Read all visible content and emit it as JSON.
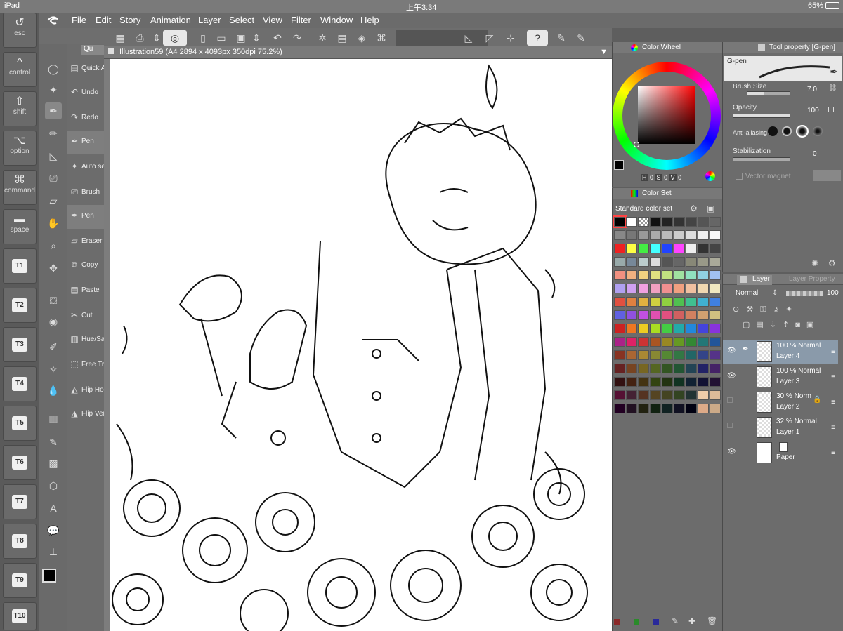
{
  "status": {
    "device": "iPad",
    "time": "上午3:34",
    "battery": "65%"
  },
  "menu": {
    "items": [
      "File",
      "Edit",
      "Story",
      "Animation",
      "Layer",
      "Select",
      "View",
      "Filter",
      "Window",
      "Help"
    ]
  },
  "keys": [
    {
      "label": "esc",
      "glyph": "↺"
    },
    {
      "label": "control",
      "glyph": "^"
    },
    {
      "label": "shift",
      "glyph": "⇧"
    },
    {
      "label": "option",
      "glyph": "⌥"
    },
    {
      "label": "command",
      "glyph": "⌘"
    },
    {
      "label": "space",
      "glyph": "▬"
    },
    {
      "label": "T1"
    },
    {
      "label": "T2"
    },
    {
      "label": "T3"
    },
    {
      "label": "T4"
    },
    {
      "label": "T5"
    },
    {
      "label": "T6"
    },
    {
      "label": "T7"
    },
    {
      "label": "T8"
    },
    {
      "label": "T9"
    },
    {
      "label": "T10"
    }
  ],
  "canvas": {
    "tab_title": "Illustration59 (A4 2894 x 4093px 350dpi 75.2%)"
  },
  "quick_panel": {
    "tab": "Qu",
    "items": [
      {
        "label": "Quick Access",
        "icon": "quick-access-icon"
      },
      {
        "label": "Undo",
        "icon": "undo-icon"
      },
      {
        "label": "Redo",
        "icon": "redo-icon"
      },
      {
        "label": "Pen",
        "icon": "pen-icon"
      },
      {
        "label": "Auto select",
        "icon": "auto-select-icon"
      },
      {
        "label": "Brush",
        "icon": "brush-icon"
      },
      {
        "label": "Pen",
        "icon": "pen-icon"
      },
      {
        "label": "Eraser",
        "icon": "eraser-icon"
      },
      {
        "label": "Copy",
        "icon": "copy-icon"
      },
      {
        "label": "Paste",
        "icon": "paste-icon"
      },
      {
        "label": "Cut",
        "icon": "cut-icon"
      },
      {
        "label": "Hue/Saturation",
        "icon": "hue-saturation-icon"
      },
      {
        "label": "Free Transform",
        "icon": "transform-icon"
      },
      {
        "label": "Flip Horizontal",
        "icon": "flip-horizontal-icon"
      },
      {
        "label": "Flip Vertical",
        "icon": "flip-vertical-icon"
      }
    ]
  },
  "color_wheel": {
    "title": "Color Wheel",
    "h_label": "H",
    "h": "0",
    "s_label": "S",
    "s": "0",
    "v_label": "V",
    "v": "0"
  },
  "color_set": {
    "title": "Color Set",
    "set_name": "Standard color set",
    "colors": [
      [
        "#000000",
        "#ffffff",
        "checker",
        "#111111",
        "#222222",
        "#333333",
        "#444444",
        "#555555",
        "#666666"
      ],
      [
        "#888888",
        "#777777",
        "#999999",
        "#aaaaaa",
        "#bbbbbb",
        "#cccccc",
        "#dddddd",
        "#eeeeee",
        "#f8f8f8"
      ],
      [
        "#ee2222",
        "#ffff44",
        "#44ee44",
        "#44ffff",
        "#2244ff",
        "#ff44ff",
        "#eeeeee",
        "#333333",
        "#444444"
      ],
      [
        "#99aaaa",
        "#778899",
        "#bbcccc",
        "#dddddd",
        "#555555",
        "#666666",
        "#888877",
        "#999988",
        "#aaaa99"
      ],
      [
        "#f09080",
        "#f0b080",
        "#f0d080",
        "#e0e080",
        "#c0e080",
        "#a0e0a0",
        "#90e0c0",
        "#90d0e0",
        "#a0c0f0"
      ],
      [
        "#b0a0f0",
        "#d0a0f0",
        "#f0a0e0",
        "#f0a0c0",
        "#f09090",
        "#f0a080",
        "#f0c0a0",
        "#f0d8b0",
        "#f0e8c0"
      ],
      [
        "#e05040",
        "#e08040",
        "#e0b040",
        "#d0d040",
        "#90d040",
        "#50c050",
        "#40c090",
        "#40b0d0",
        "#4080e0"
      ],
      [
        "#6060e0",
        "#9050e0",
        "#c050e0",
        "#e050b0",
        "#e05080",
        "#d06060",
        "#d08060",
        "#d0a070",
        "#d0c080"
      ],
      [
        "#cc2222",
        "#ee7722",
        "#eecc22",
        "#aadd22",
        "#44cc44",
        "#22aaaa",
        "#2288dd",
        "#4444dd",
        "#8833dd"
      ],
      [
        "#aa2288",
        "#dd2266",
        "#cc3333",
        "#aa5522",
        "#998822",
        "#669922",
        "#338833",
        "#227777",
        "#225599"
      ],
      [
        "#883322",
        "#aa6633",
        "#aa8833",
        "#888833",
        "#558833",
        "#337744",
        "#226666",
        "#334488",
        "#553388"
      ],
      [
        "#662222",
        "#774422",
        "#776622",
        "#556622",
        "#335522",
        "#225533",
        "#224455",
        "#222266",
        "#442266"
      ],
      [
        "#331111",
        "#442211",
        "#443311",
        "#334411",
        "#223311",
        "#113322",
        "#112233",
        "#111133",
        "#221133"
      ],
      [
        "#551133",
        "#442233",
        "#553322",
        "#554422",
        "#444422",
        "#334422",
        "#223333",
        "#eeccaa",
        "#ddbb99"
      ],
      [
        "#220022",
        "#221122",
        "#222211",
        "#112211",
        "#112222",
        "#111122",
        "#000011",
        "#ddaa88",
        "#ccaa88"
      ]
    ]
  },
  "tool_property": {
    "title": "Tool property [G-pen]",
    "brush_name": "G-pen",
    "brush_size_label": "Brush Size",
    "brush_size": "7.0",
    "brush_size_level": 0.4,
    "opacity_label": "Opacity",
    "opacity": "100",
    "opacity_level": 1.0,
    "aa_label": "Anti-aliasing",
    "stab_label": "Stabilization",
    "stab": "0",
    "stab_level": 0.0,
    "vector_label": "Vector magnet"
  },
  "layer_panel": {
    "tab_layer": "Layer",
    "tab_prop": "Layer Property",
    "blend": "Normal",
    "opacity": "100",
    "layers": [
      {
        "mode": "100 % Normal",
        "name": "Layer 4",
        "selected": true,
        "visible": true
      },
      {
        "mode": "100 % Normal",
        "name": "Layer 3",
        "selected": false,
        "visible": true
      },
      {
        "mode": "30 % Norm",
        "name": "Layer 2",
        "selected": false,
        "visible": false
      },
      {
        "mode": "32 % Normal",
        "name": "Layer 1",
        "selected": false,
        "visible": false
      },
      {
        "mode": "",
        "name": "Paper",
        "selected": false,
        "visible": true
      }
    ]
  }
}
